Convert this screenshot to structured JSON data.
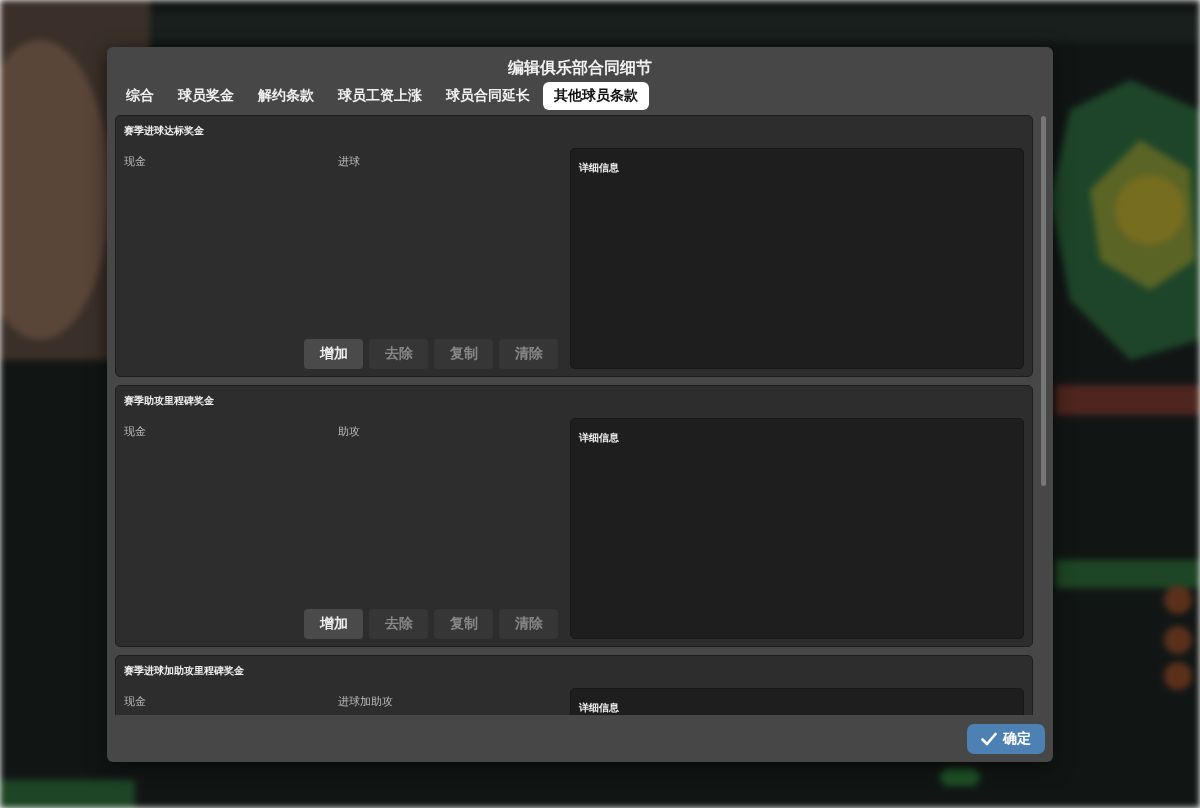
{
  "dialog": {
    "title": "编辑俱乐部合同细节",
    "tabs": [
      {
        "label": "综合",
        "selected": false
      },
      {
        "label": "球员奖金",
        "selected": false
      },
      {
        "label": "解约条款",
        "selected": false
      },
      {
        "label": "球员工资上涨",
        "selected": false
      },
      {
        "label": "球员合同延长",
        "selected": false
      },
      {
        "label": "其他球员条款",
        "selected": true
      }
    ],
    "sections": [
      {
        "title": "赛季进球达标奖金",
        "columns": [
          "现金",
          "进球"
        ],
        "details_label": "详细信息",
        "buttons": [
          {
            "label": "增加",
            "disabled": false
          },
          {
            "label": "去除",
            "disabled": true
          },
          {
            "label": "复制",
            "disabled": true
          },
          {
            "label": "清除",
            "disabled": true
          }
        ]
      },
      {
        "title": "赛季助攻里程碑奖金",
        "columns": [
          "现金",
          "助攻"
        ],
        "details_label": "详细信息",
        "buttons": [
          {
            "label": "增加",
            "disabled": false
          },
          {
            "label": "去除",
            "disabled": true
          },
          {
            "label": "复制",
            "disabled": true
          },
          {
            "label": "清除",
            "disabled": true
          }
        ]
      },
      {
        "title": "赛季进球加助攻里程碑奖金",
        "columns": [
          "现金",
          "进球加助攻"
        ],
        "details_label": "详细信息"
      }
    ],
    "confirm_button": "确定"
  }
}
